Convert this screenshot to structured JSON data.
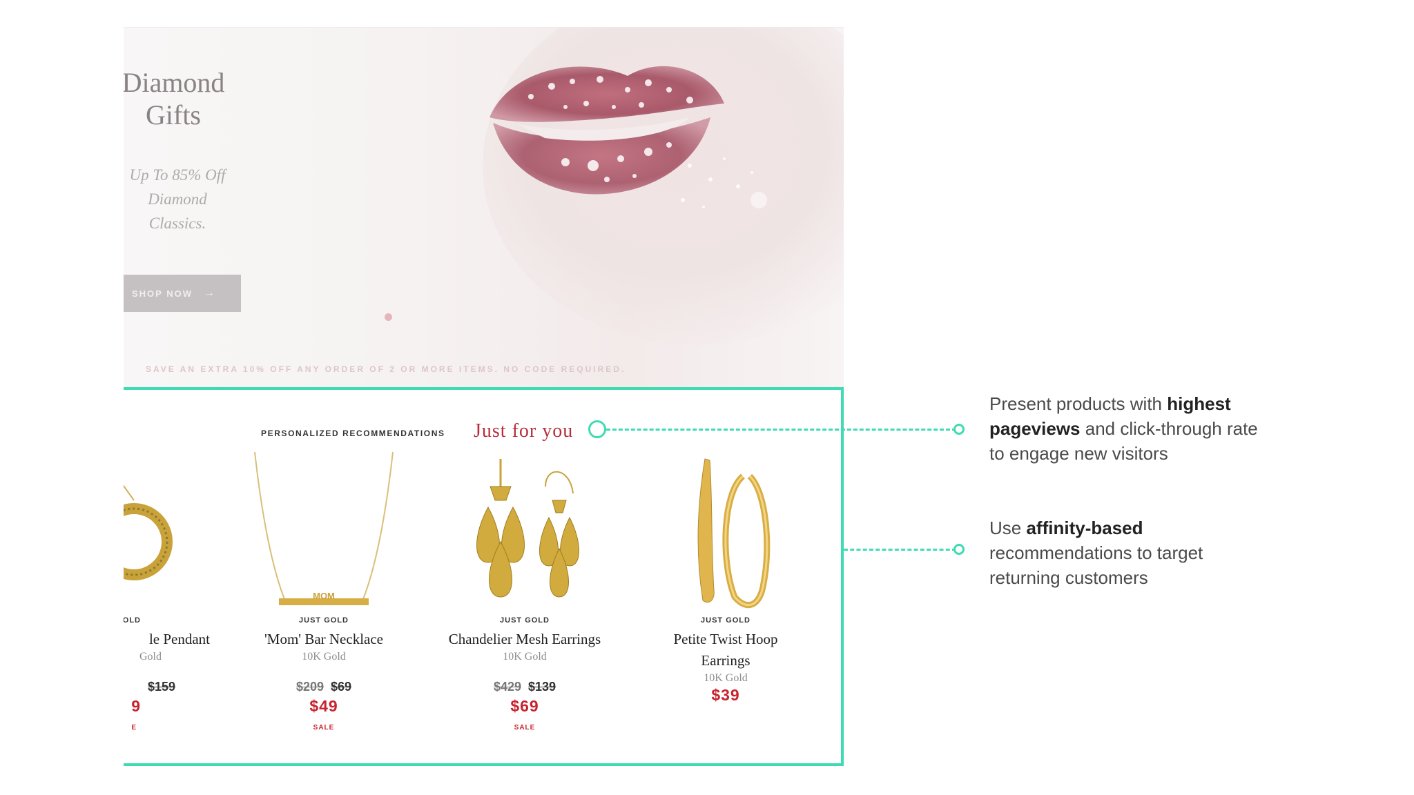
{
  "hero": {
    "title_line1": "Diamond",
    "title_line2": "Gifts",
    "subtitle_line1": "Up To 85% Off",
    "subtitle_line2": "Diamond",
    "subtitle_line3": "Classics.",
    "shop_button": "SHOP NOW",
    "arrow_icon": "arrow-right-icon",
    "promo": "SAVE AN EXTRA 10% OFF ANY ORDER OF 2 OR MORE ITEMS. NO CODE REQUIRED."
  },
  "recommendations": {
    "label": "PERSONALIZED RECOMMENDATIONS",
    "title": "Just for you",
    "products": [
      {
        "brand": "GOLD",
        "name": "le Pendant",
        "metal": "Gold",
        "original_price": "$159",
        "sale_price": "9",
        "sale_tag": "E",
        "image_icon": "circle-pendant-icon"
      },
      {
        "brand": "JUST GOLD",
        "name": "'Mom' Bar Necklace",
        "metal": "10K Gold",
        "original_price": "$209",
        "discount_price": "$69",
        "sale_price": "$49",
        "sale_tag": "SALE",
        "image_icon": "bar-necklace-icon"
      },
      {
        "brand": "JUST GOLD",
        "name": "Chandelier Mesh Earrings",
        "metal": "10K Gold",
        "original_price": "$429",
        "discount_price": "$139",
        "sale_price": "$69",
        "sale_tag": "SALE",
        "image_icon": "chandelier-earrings-icon"
      },
      {
        "brand": "JUST GOLD",
        "name_line1": "Petite Twist Hoop",
        "name_line2": "Earrings",
        "metal": "10K Gold",
        "sale_price": "$39",
        "image_icon": "hoop-earrings-icon"
      }
    ]
  },
  "callouts": {
    "first": {
      "pre": "Present products with ",
      "bold": "highest",
      "bold2": "pageviews",
      "post": " and click-through rate",
      "line3": "to engage new visitors"
    },
    "second": {
      "pre": "Use ",
      "bold": "affinity-based",
      "line2": "recommendations to target",
      "line3": "returning customers"
    }
  },
  "colors": {
    "accent": "#3fdbb3",
    "sale": "#c8222e",
    "script": "#b52e3c"
  }
}
